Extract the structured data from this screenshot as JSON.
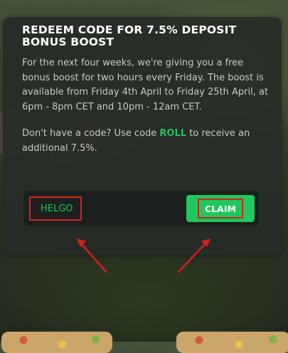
{
  "modal": {
    "title": "REDEEM CODE FOR 7.5% DEPOSIT BONUS BOOST",
    "description": "For the next four weeks, we're giving you a free bonus boost for two hours every Friday. The boost is available from Friday 4th April to Friday 25th April, at 6pm - 8pm CET and 10pm - 12am CET.",
    "promo_prefix": "Don't have a code? Use code ",
    "promo_code": "ROLL",
    "promo_suffix": " to receive an additional 7.5%."
  },
  "redeem": {
    "code_value": "HELGO",
    "claim_label": "CLAIM"
  },
  "colors": {
    "accent_green": "#1ec85a",
    "annotation_red": "#d61f1f"
  },
  "icons": [
    "arrow-annotation-icon"
  ]
}
